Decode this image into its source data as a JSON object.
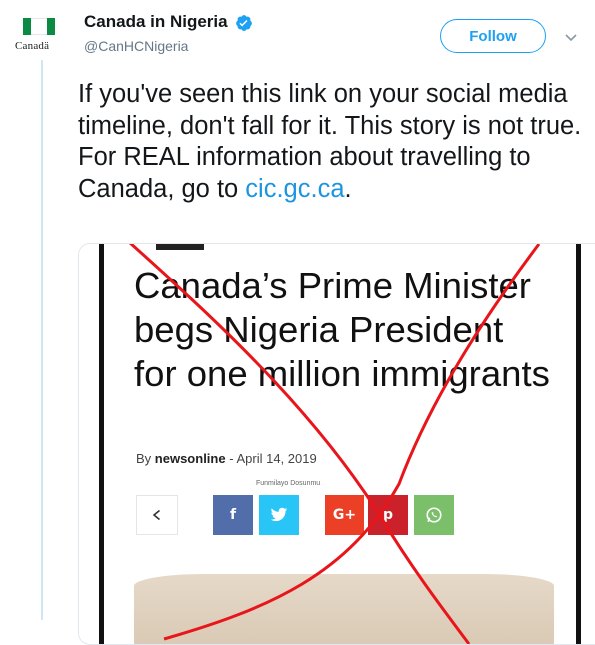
{
  "account": {
    "display_name": "Canada in Nigeria",
    "handle": "@CanHCNigeria",
    "avatar_wordmark": "Canadä",
    "verified": true
  },
  "follow_button": {
    "label": "Follow"
  },
  "tweet": {
    "text": "If you've seen this link on your social media timeline, don't fall for it.  This story is not true.  For REAL information about travelling to Canada, go to ",
    "link": "cic.gc.ca",
    "trailing": "."
  },
  "article": {
    "headline": "Canada’s Prime Minister begs Nigeria President for one million immigrants",
    "by_prefix": "By",
    "author": "newsonline",
    "separator": "-",
    "date": "April 14, 2019",
    "photo_credit": "Funmilayo Dosunmu"
  },
  "share_buttons": [
    {
      "name": "share-icon"
    },
    {
      "name": "facebook-icon",
      "glyph": "f",
      "color": "#516eab"
    },
    {
      "name": "twitter-icon",
      "color": "#29c5f6"
    },
    {
      "name": "google-plus-icon",
      "glyph": "G+",
      "color": "#eb4026"
    },
    {
      "name": "pinterest-icon",
      "glyph": "p",
      "color": "#ca212a"
    },
    {
      "name": "whatsapp-icon",
      "color": "#7bbf6a"
    }
  ],
  "colors": {
    "accent": "#1da1f2",
    "link": "#1b95e0",
    "cross": "#e8151b",
    "flag_green": "#0a8a42"
  }
}
